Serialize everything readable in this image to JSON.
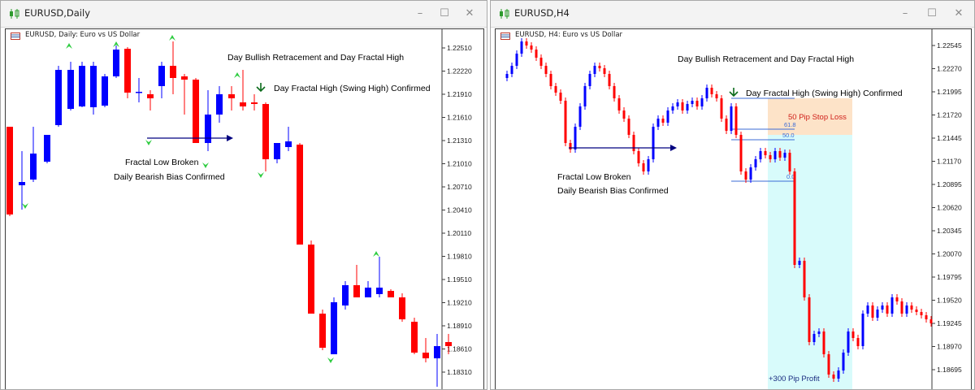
{
  "windows": [
    {
      "title": "EURUSD,Daily",
      "symbol_label": "EURUSD, Daily:  Euro vs US Dollar",
      "price_axis": [
        "1.22510",
        "1.22220",
        "1.21910",
        "1.21610",
        "1.21310",
        "1.21010",
        "1.20710",
        "1.20410",
        "1.20110",
        "1.19810",
        "1.19510",
        "1.19210",
        "1.18910",
        "1.18610",
        "1.18310"
      ],
      "annotations": [
        "Day Bullish Retracement and Day Fractal High",
        "Day Fractal High (Swing High) Confirmed",
        "Fractal Low Broken",
        "Daily Bearish Bias Confirmed"
      ]
    },
    {
      "title": "EURUSD,H4",
      "symbol_label": "EURUSD, H4:  Euro vs US Dollar",
      "price_axis": [
        "1.22545",
        "1.22270",
        "1.21995",
        "1.21720",
        "1.21445",
        "1.21170",
        "1.20895",
        "1.20620",
        "1.20345",
        "1.20070",
        "1.19795",
        "1.19520",
        "1.19245",
        "1.18970",
        "1.18695"
      ],
      "annotations": [
        "Day Bullish Retracement and Day Fractal High",
        "Day Fractal High (Swing High) Confirmed",
        "Fractal Low Broken",
        "Daily Bearish Bias Confirmed",
        "50 Pip Stop Loss",
        "+300 Pip Profit"
      ],
      "fib_levels": [
        "61.8",
        "50.0",
        "0.0"
      ]
    }
  ],
  "controls": {
    "minimize": "–",
    "maximize": "☐",
    "close": "✕"
  },
  "colors": {
    "bull": "#0000ff",
    "bear": "#ff0000",
    "fractal": "#2ecc40",
    "arrow": "#000080",
    "stop_zone": "#fde3c8",
    "profit_zone": "#d8fbfb",
    "fib": "#3b6bd6"
  }
}
